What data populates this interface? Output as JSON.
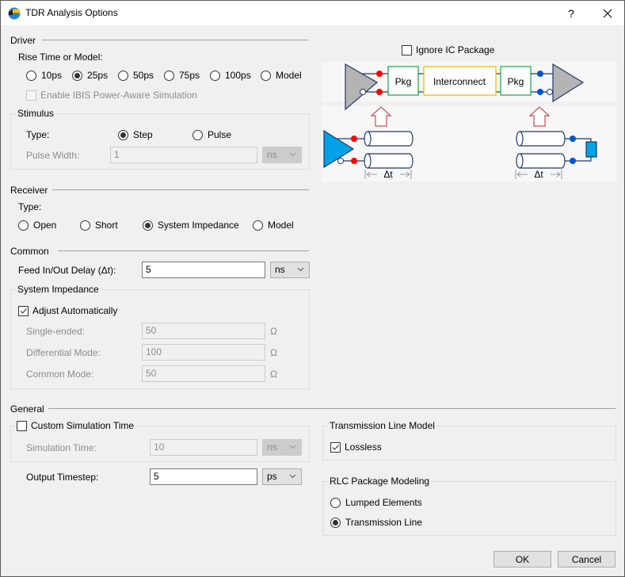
{
  "window": {
    "title": "TDR Analysis Options",
    "help_label": "?",
    "close_icon": "close-icon",
    "app_icon": "app-logo-icon"
  },
  "driver": {
    "section_title": "Driver",
    "rise_label": "Rise Time or Model:",
    "rise_options": [
      {
        "label": "10ps",
        "selected": false
      },
      {
        "label": "25ps",
        "selected": true
      },
      {
        "label": "50ps",
        "selected": false
      },
      {
        "label": "75ps",
        "selected": false
      },
      {
        "label": "100ps",
        "selected": false
      },
      {
        "label": "Model",
        "selected": false
      }
    ],
    "ibis_power_aware": {
      "label": "Enable IBIS Power-Aware Simulation",
      "checked": false,
      "enabled": false
    },
    "stimulus": {
      "group_title": "Stimulus",
      "type_label": "Type:",
      "type_options": [
        {
          "label": "Step",
          "selected": true
        },
        {
          "label": "Pulse",
          "selected": false
        }
      ],
      "pulse_width_label": "Pulse Width:",
      "pulse_width_value": "1",
      "pulse_width_unit": "ns"
    }
  },
  "receiver": {
    "section_title": "Receiver",
    "type_label": "Type:",
    "type_options": [
      {
        "label": "Open",
        "selected": false
      },
      {
        "label": "Short",
        "selected": false
      },
      {
        "label": "System Impedance",
        "selected": true
      },
      {
        "label": "Model",
        "selected": false
      }
    ]
  },
  "common": {
    "section_title": "Common",
    "delay_label": "Feed In/Out Delay (Δt):",
    "delay_value": "5",
    "delay_unit": "ns",
    "system_impedance": {
      "group_title": "System Impedance",
      "adjust_label": "Adjust Automatically",
      "adjust_checked": true,
      "fields": [
        {
          "label": "Single-ended:",
          "value": "50",
          "unit": "Ω"
        },
        {
          "label": "Differential Mode:",
          "value": "100",
          "unit": "Ω"
        },
        {
          "label": "Common Mode:",
          "value": "50",
          "unit": "Ω"
        }
      ]
    }
  },
  "diagram": {
    "ignore_ic_package_label": "Ignore IC Package",
    "ignore_ic_package_checked": false,
    "pkg_left": "Pkg",
    "interconnect": "Interconnect",
    "pkg_right": "Pkg",
    "delta_left": "Δt",
    "delta_right": "Δt",
    "colors": {
      "driver_port": "#ff0000",
      "receiver_port": "#0055cc",
      "pkg_border": "#1aa04a",
      "interconnect_border": "#f2b500",
      "source_triangle": "#00a2e8",
      "buffer_triangle": "#b4b4b4",
      "arrow": "#cc2222",
      "wire": "#1f3a68"
    }
  },
  "general": {
    "section_title": "General",
    "custom_sim_time_label": "Custom Simulation Time",
    "custom_sim_time_checked": false,
    "sim_time_label": "Simulation Time:",
    "sim_time_value": "10",
    "sim_time_unit": "ns",
    "output_timestep_label": "Output Timestep:",
    "output_timestep_value": "5",
    "output_timestep_unit": "ps",
    "tline_model": {
      "group_title": "Transmission Line Model",
      "lossless_label": "Lossless",
      "lossless_checked": true
    },
    "rlc_package": {
      "group_title": "RLC Package Modeling",
      "options": [
        {
          "label": "Lumped Elements",
          "selected": false
        },
        {
          "label": "Transmission Line",
          "selected": true
        }
      ]
    }
  },
  "buttons": {
    "ok": "OK",
    "cancel": "Cancel"
  }
}
